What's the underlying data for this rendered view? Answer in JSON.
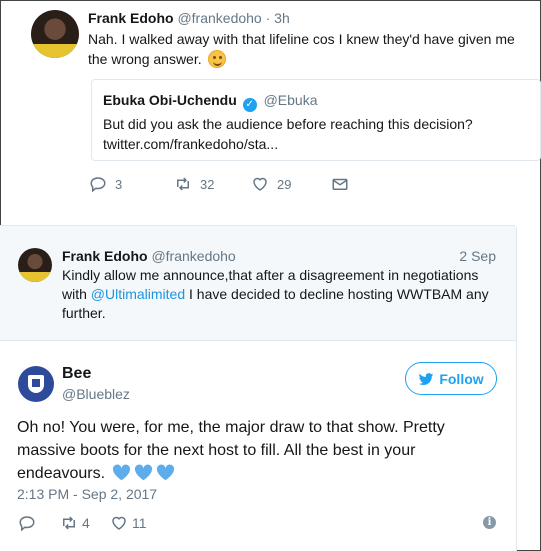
{
  "tweet": {
    "author_name": "Frank Edoho",
    "author_handle": "@frankedoho",
    "age": "· 3h",
    "text": "Nah. I walked away with that lifeline cos I knew they'd have given me the wrong answer.",
    "emoji": "smiling-face-with-smiling-eyes",
    "quoted": {
      "author_name": "Ebuka Obi-Uchendu",
      "author_handle": "@Ebuka",
      "verified": true,
      "text_line1": "But did you ask the audience before reaching this decision?",
      "text_line2": "twitter.com/frankedoho/sta..."
    },
    "actions": {
      "replies": "3",
      "retweets": "32",
      "likes": "29",
      "message_icon": "envelope-icon"
    }
  },
  "embed": {
    "quoted_tweet": {
      "author_name": "Frank Edoho",
      "author_handle": "@frankedoho",
      "date": "2 Sep",
      "text_before": "Kindly allow me announce,that after a disagreement in negotiations with ",
      "mention": "@Ultimalimited",
      "text_after": " I have decided to decline hosting WWTBAM any further."
    },
    "author": {
      "name": "Bee",
      "handle": "@Blueblez",
      "avatar_colors": "#2d4a9b"
    },
    "follow_label": "Follow",
    "text": "Oh no! You were, for me, the major draw to that show. Pretty massive boots for the next host to fill. All the best in your endeavours.",
    "emoji": [
      "blue-heart",
      "blue-heart",
      "blue-heart"
    ],
    "timestamp": "2:13 PM - Sep 2, 2017",
    "actions": {
      "retweets": "4",
      "likes": "11"
    },
    "colors": {
      "accent": "#1da1f2",
      "mention": "#1b95e0",
      "muted": "#657786",
      "heart_blue": "#5dadec"
    }
  }
}
